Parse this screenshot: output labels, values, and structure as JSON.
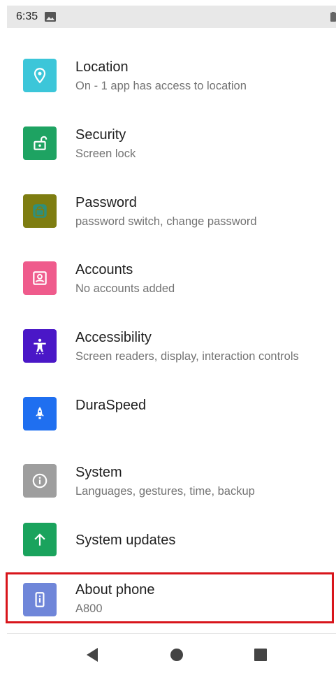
{
  "status_bar": {
    "time": "6:35",
    "icons": [
      "image-icon",
      "battery-icon"
    ]
  },
  "settings": [
    {
      "title": "Location",
      "subtitle": "On - 1 app has access to location",
      "icon": "location-pin-icon",
      "color": "#3cc6d9"
    },
    {
      "title": "Security",
      "subtitle": "Screen lock",
      "icon": "unlock-icon",
      "color": "#1ea362"
    },
    {
      "title": "Password",
      "subtitle": "password switch, change password",
      "icon": "password-icon",
      "color": "#7e7d11"
    },
    {
      "title": "Accounts",
      "subtitle": "No accounts added",
      "icon": "account-icon",
      "color": "#ef5b8c"
    },
    {
      "title": "Accessibility",
      "subtitle": "Screen readers, display, interaction controls",
      "icon": "accessibility-icon",
      "color": "#4a17c7"
    },
    {
      "title": "DuraSpeed",
      "subtitle": "",
      "icon": "rocket-icon",
      "color": "#1f6ff0"
    },
    {
      "title": "System",
      "subtitle": "Languages, gestures, time, backup",
      "icon": "info-icon",
      "color": "#9e9e9e"
    },
    {
      "title": "System updates",
      "subtitle": "",
      "icon": "arrow-up-icon",
      "color": "#1aa35d"
    },
    {
      "title": "About phone",
      "subtitle": "A800",
      "icon": "phone-icon",
      "color": "#6f86d9"
    }
  ],
  "highlight_color": "#d8151b",
  "nav": [
    "back-icon",
    "home-icon",
    "recents-icon"
  ]
}
